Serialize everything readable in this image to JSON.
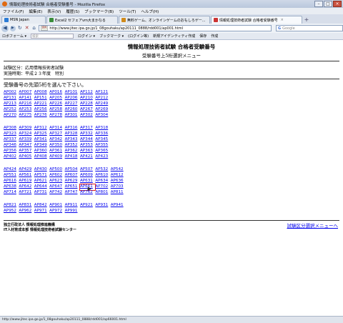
{
  "window": {
    "title": "情報処理技術者試験 合格者受験番号 - Mozilla Firefox"
  },
  "menu": [
    "ファイル(F)",
    "編集(E)",
    "表示(V)",
    "履歴(S)",
    "ブックマーク(B)",
    "ツール(T)",
    "ヘルプ(H)"
  ],
  "tabs": [
    {
      "label": "MSN Japan"
    },
    {
      "label": "Excel2 セフェアvm大まかなる"
    },
    {
      "label": "無料ゲーム、オンラインゲームのおもしろゲー..."
    },
    {
      "label": "情報処理技術者試験 合格者受験番号",
      "active": true
    }
  ],
  "nav": {
    "url": "http://www.jitec.ipa.go.jp/1_08gouhaku/ap20111_0888/rdd001/ap001.html",
    "site_badge": "IPA",
    "search_placeholder": "Google"
  },
  "bookmarks": [
    "ロボフォーム ▾",
    "検索",
    "ログイン ▾",
    "ブックマーク ▾",
    "(ログイン等)",
    "新規アイデンティティ作成",
    "保存",
    "作成"
  ],
  "page": {
    "title": "情報処理技術者試験 合格者受験番号",
    "subtitle": "受験番号上5桁選択メニュー",
    "exam_category": "試験区分：応用情報技術者試験",
    "exam_date": "実施時期：平成２３年度　特別",
    "instruction": "受験番号の先頭5桁を選んで下さい。",
    "groups": [
      [
        [
          "AP002",
          "AP007",
          "AP008",
          "AP016",
          "AP101",
          "AP112",
          "AP121"
        ],
        [
          "AP131",
          "AP141",
          "AP151",
          "AP205",
          "AP206",
          "AP210",
          "AP212"
        ],
        [
          "AP213",
          "AP216",
          "AP221",
          "AP226",
          "AP227",
          "AP228",
          "AP249"
        ],
        [
          "AP252",
          "AP253",
          "AP256",
          "AP258",
          "AP260",
          "AP267",
          "AP269"
        ],
        [
          "AP270",
          "AP275",
          "AP276",
          "AP278",
          "AP301",
          "AP302",
          "AP304"
        ]
      ],
      [
        [
          "AP308",
          "AP309",
          "AP312",
          "AP314",
          "AP316",
          "AP317",
          "AP318"
        ],
        [
          "AP323",
          "AP324",
          "AP325",
          "AP327",
          "AP328",
          "AP332",
          "AP336"
        ],
        [
          "AP337",
          "AP339",
          "AP341",
          "AP342",
          "AP343",
          "AP344",
          "AP345"
        ],
        [
          "AP346",
          "AP347",
          "AP349",
          "AP350",
          "AP352",
          "AP353",
          "AP355"
        ],
        [
          "AP356",
          "AP357",
          "AP360",
          "AP361",
          "AP362",
          "AP363",
          "AP365"
        ],
        [
          "AP402",
          "AP405",
          "AP408",
          "AP409",
          "AP418",
          "AP421",
          "AP423"
        ]
      ],
      [
        [
          "AP424",
          "AP429",
          "AP430",
          "AP500",
          "AP504",
          "AP507",
          "AP532",
          "AP542"
        ],
        [
          "AP551",
          "AP561",
          "AP571",
          "AP602",
          "AP607",
          "AP609",
          "AP610",
          "AP612"
        ],
        [
          "AP616",
          "AP619",
          "AP621",
          "AP623",
          "AP629",
          "AP631",
          "AP634",
          "AP636"
        ],
        [
          "AP638",
          "AP642",
          "AP644",
          "AP647",
          "AP651",
          "AP661",
          "AP702",
          "AP703"
        ],
        [
          "AP714",
          "AP721",
          "AP731",
          "AP742",
          "AP747",
          "AP762",
          "AP801",
          "AP811"
        ]
      ],
      [
        [
          "AP821",
          "AP831",
          "AP842",
          "AP901",
          "AP911",
          "AP921",
          "AP931",
          "AP941"
        ],
        [
          "AP952",
          "AP962",
          "AP971",
          "AP972",
          "AP991"
        ]
      ]
    ],
    "selected": "AP661",
    "footer_org_1": "独立行政法人 情報処理推進機構",
    "footer_org_2": "IT人材育成本部 情報処理技術者試験センター",
    "back_link": "試験区分選択メニューへ"
  },
  "status": {
    "text": "http://www.jitec.ipa.go.jp/1_08gouhaku/ap20111_0888/rdd001/ap66001.html"
  }
}
